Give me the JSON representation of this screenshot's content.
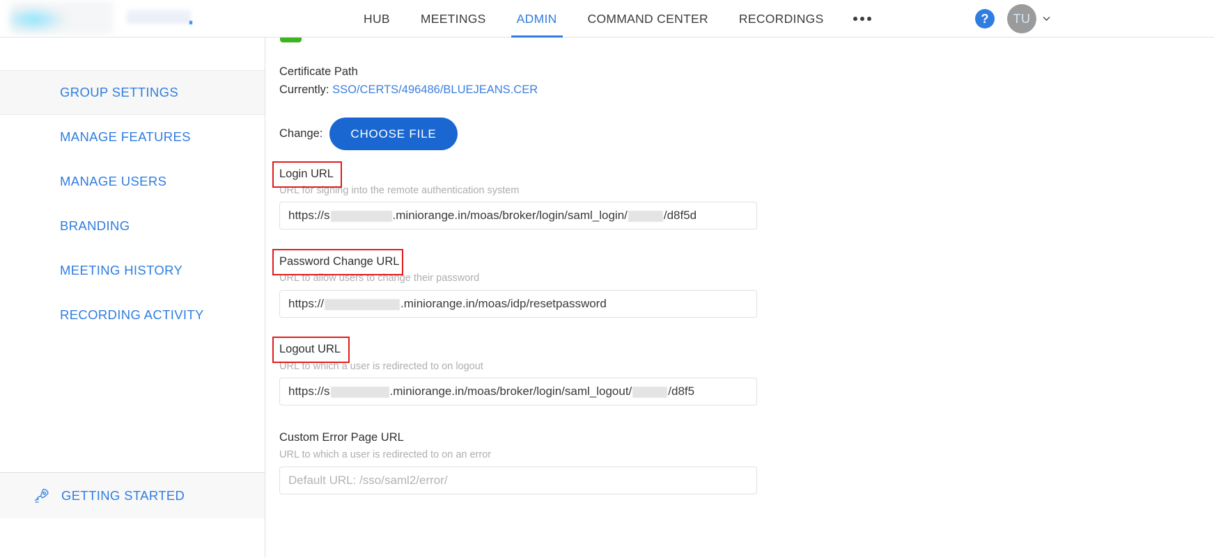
{
  "header": {
    "nav": [
      {
        "label": "HUB",
        "active": false
      },
      {
        "label": "MEETINGS",
        "active": false
      },
      {
        "label": "ADMIN",
        "active": true
      },
      {
        "label": "COMMAND CENTER",
        "active": false
      },
      {
        "label": "RECORDINGS",
        "active": false
      }
    ],
    "more_label": "•••",
    "help_label": "?",
    "avatar_initials": "TU",
    "accent_color": "#2f7de1"
  },
  "sidebar": {
    "items": [
      {
        "label": "GROUP SETTINGS",
        "active": true
      },
      {
        "label": "MANAGE FEATURES",
        "active": false
      },
      {
        "label": "MANAGE USERS",
        "active": false
      },
      {
        "label": "BRANDING",
        "active": false
      },
      {
        "label": "MEETING HISTORY",
        "active": false
      },
      {
        "label": "RECORDING ACTIVITY",
        "active": false
      }
    ],
    "getting_started": "GETTING STARTED"
  },
  "main": {
    "certificate": {
      "title": "Certificate Path",
      "currently_label": "Currently:",
      "currently_value": "SSO/CERTS/496486/BLUEJEANS.CER",
      "change_label": "Change:",
      "choose_file_label": "CHOOSE FILE"
    },
    "fields": [
      {
        "label": "Login URL",
        "help": "URL for signing into the remote authentication system",
        "value_prefix": "https://s",
        "value_suffix": ".miniorange.in/moas/broker/login/saml_login/",
        "value_tail": "/d8f5d",
        "redacted": true,
        "annotated": true
      },
      {
        "label": "Password Change URL",
        "help": "URL to allow users to change their password",
        "value_prefix": "https://",
        "value_suffix": ".miniorange.in/moas/idp/resetpassword",
        "value_tail": "",
        "redacted": true,
        "annotated": true
      },
      {
        "label": "Logout URL",
        "help": "URL to which a user is redirected to on logout",
        "value_prefix": "https://s",
        "value_suffix": ".miniorange.in/moas/broker/login/saml_logout/",
        "value_tail": "/d8f5",
        "redacted": true,
        "annotated": true
      },
      {
        "label": "Custom Error Page URL",
        "help": "URL to which a user is redirected to on an error",
        "value_prefix": "",
        "value_suffix": "",
        "value_tail": "",
        "placeholder": "Default URL: /sso/saml2/error/",
        "redacted": false,
        "annotated": false
      }
    ]
  }
}
